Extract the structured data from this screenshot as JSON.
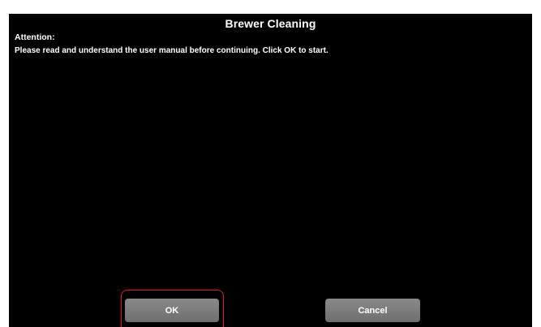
{
  "dialog": {
    "title": "Brewer Cleaning",
    "attention_label": "Attention:",
    "message": "Please read and understand the user manual before continuing.  Click OK to start."
  },
  "buttons": {
    "ok_label": "OK",
    "cancel_label": "Cancel"
  },
  "colors": {
    "background": "#000000",
    "text": "#ffffff",
    "button": "#7a7a7a",
    "highlight": "#e01e1e"
  }
}
